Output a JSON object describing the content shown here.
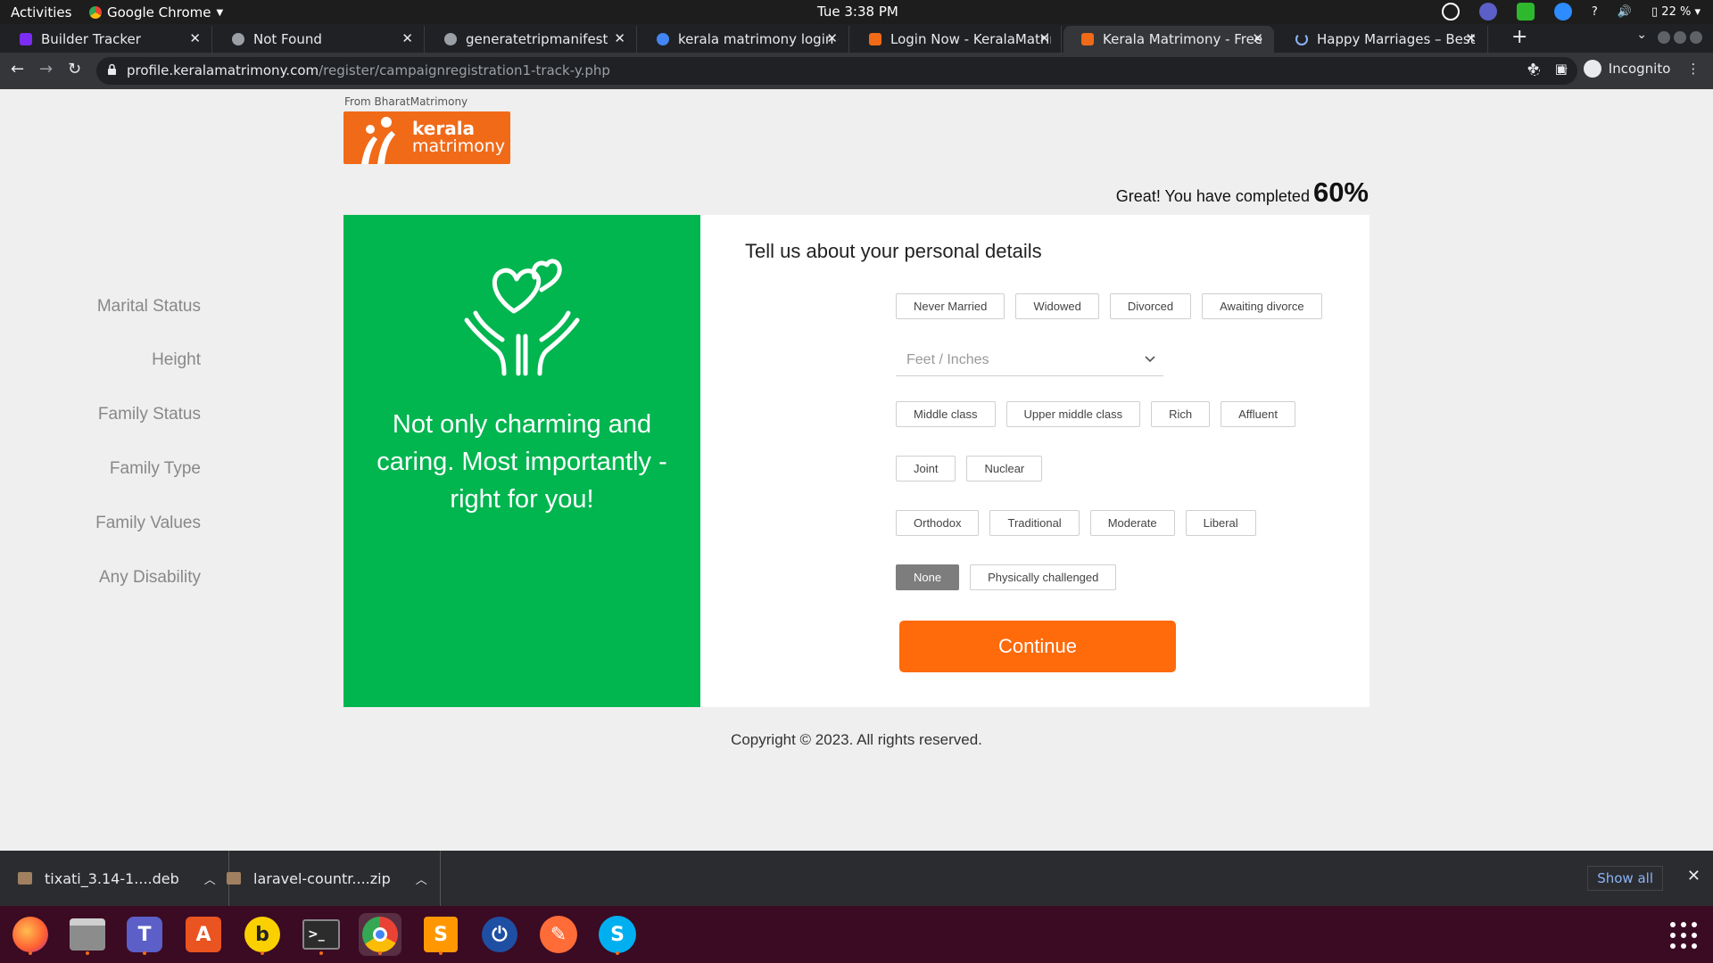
{
  "system": {
    "activities": "Activities",
    "app_name": "Google Chrome",
    "clock": "Tue  3:38 PM",
    "battery": "22 %"
  },
  "tabs": [
    {
      "title": "Builder Tracker",
      "active": false,
      "favicon_color": "#7b2cf5"
    },
    {
      "title": "Not Found",
      "active": false,
      "favicon_color": "#9aa0a6"
    },
    {
      "title": "generatetripmanifest",
      "active": false,
      "favicon_color": "#9aa0a6"
    },
    {
      "title": "kerala matrimony login - C",
      "active": false,
      "favicon_color": "#4285f4"
    },
    {
      "title": "Login Now - KeralaMatrim",
      "active": false,
      "favicon_color": "#f06a18"
    },
    {
      "title": "Kerala Matrimony - Free M",
      "active": true,
      "favicon_color": "#f06a18"
    },
    {
      "title": "Happy Marriages – Best M",
      "active": false,
      "favicon_color": "#8ab4f8"
    }
  ],
  "omnibox": {
    "host": "profile.keralamatrimony.com",
    "path": "/register/campaignregistration1-track-y.php"
  },
  "toolbar": {
    "incognito_label": "Incognito"
  },
  "page": {
    "from_label": "From BharatMatrimony",
    "logo_line1": "kerala",
    "logo_line2": "matrimony",
    "progress_text": "Great! You have completed",
    "progress_value": "60%",
    "tagline": "Not only charming and caring. Most importantly - right for you!",
    "form_title": "Tell us about your personal details",
    "rows": [
      {
        "label": "Marital Status",
        "options": [
          "Never Married",
          "Widowed",
          "Divorced",
          "Awaiting divorce"
        ],
        "selected": null
      },
      {
        "label": "Family Status",
        "options": [
          "Middle class",
          "Upper middle class",
          "Rich",
          "Affluent"
        ],
        "selected": null
      },
      {
        "label": "Family Type",
        "options": [
          "Joint",
          "Nuclear"
        ],
        "selected": null
      },
      {
        "label": "Family Values",
        "options": [
          "Orthodox",
          "Traditional",
          "Moderate",
          "Liberal"
        ],
        "selected": null
      },
      {
        "label": "Any Disability",
        "options": [
          "None",
          "Physically challenged"
        ],
        "selected": "None"
      }
    ],
    "height": {
      "label": "Height",
      "placeholder": "Feet / Inches"
    },
    "continue_label": "Continue",
    "copyright": "Copyright © 2023. All rights reserved."
  },
  "downloads": {
    "items": [
      "tixati_3.14-1....deb",
      "laravel-countr....zip"
    ],
    "show_all": "Show all"
  },
  "colors": {
    "brand_orange": "#f06a18",
    "panel_green": "#01b54f",
    "button_orange": "#ff6a0a",
    "selected_option": "#7d7d7d"
  }
}
